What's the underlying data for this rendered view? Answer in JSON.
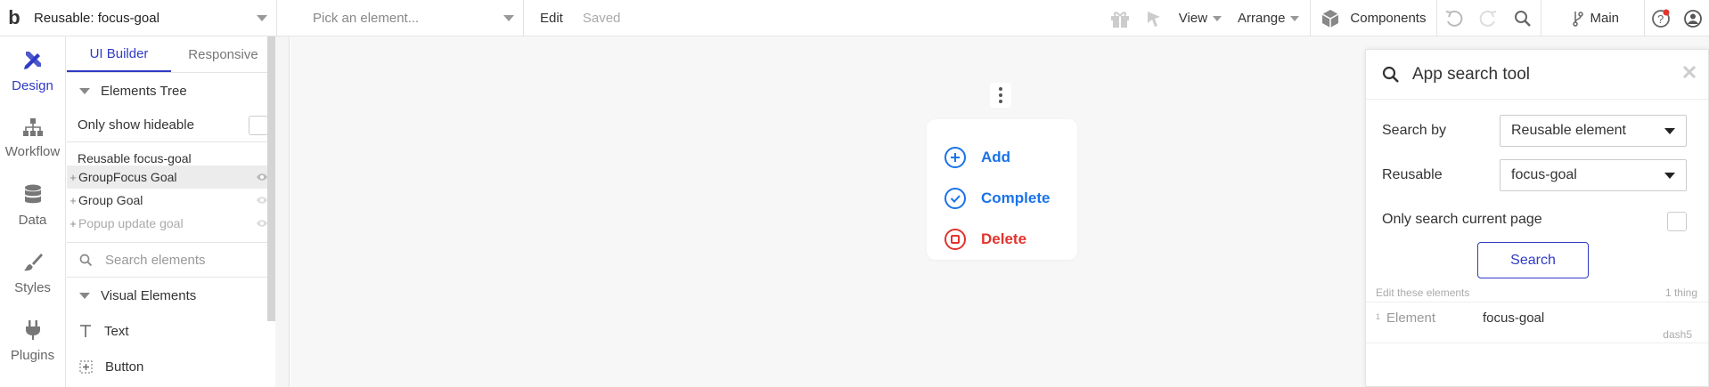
{
  "topbar": {
    "logo_text": "b",
    "page_select": "Reusable: focus-goal",
    "element_picker_placeholder": "Pick an element...",
    "edit_label": "Edit",
    "saved_label": "Saved",
    "view_label": "View",
    "arrange_label": "Arrange",
    "components_label": "Components",
    "branch_label": "Main",
    "notification_color": "#e2332c"
  },
  "rail": {
    "items": [
      {
        "label": "Design",
        "icon": "design-icon"
      },
      {
        "label": "Workflow",
        "icon": "workflow-icon"
      },
      {
        "label": "Data",
        "icon": "database-icon"
      },
      {
        "label": "Styles",
        "icon": "brush-icon"
      },
      {
        "label": "Plugins",
        "icon": "plug-icon"
      }
    ],
    "active": "Design"
  },
  "panel": {
    "tabs": [
      "UI Builder",
      "Responsive"
    ],
    "elements_tree_label": "Elements Tree",
    "only_hideable_label": "Only show hideable",
    "tree_root": "Reusable focus-goal",
    "tree_items": [
      {
        "label": "GroupFocus Goal",
        "selected": true,
        "dim": false
      },
      {
        "label": "Group Goal",
        "selected": false,
        "dim": false
      },
      {
        "label": "Popup update goal",
        "selected": false,
        "dim": true
      }
    ],
    "search_placeholder": "Search elements",
    "visual_elements_label": "Visual Elements",
    "visual_items": [
      {
        "label": "Text",
        "icon": "text-icon"
      },
      {
        "label": "Button",
        "icon": "button-icon"
      }
    ]
  },
  "canvas": {
    "actions": [
      {
        "label": "Add",
        "icon": "plus-circle-icon",
        "color": "#1a73e8"
      },
      {
        "label": "Complete",
        "icon": "check-circle-icon",
        "color": "#1a73e8"
      },
      {
        "label": "Delete",
        "icon": "stop-circle-icon",
        "color": "#e2332c"
      }
    ]
  },
  "search_tool": {
    "title": "App search tool",
    "search_by_label": "Search by",
    "search_by_value": "Reusable element",
    "reusable_label": "Reusable",
    "reusable_value": "focus-goal",
    "only_current_page_label": "Only search current page",
    "search_button": "Search",
    "results_header": "Edit these elements",
    "results_count": "1 thing",
    "results": [
      {
        "num": "1",
        "type": "Element",
        "name": "focus-goal",
        "page": "dash5"
      }
    ]
  },
  "colors": {
    "accent": "#2f3bc4",
    "action_blue": "#1a73e8",
    "danger_red": "#e2332c"
  }
}
